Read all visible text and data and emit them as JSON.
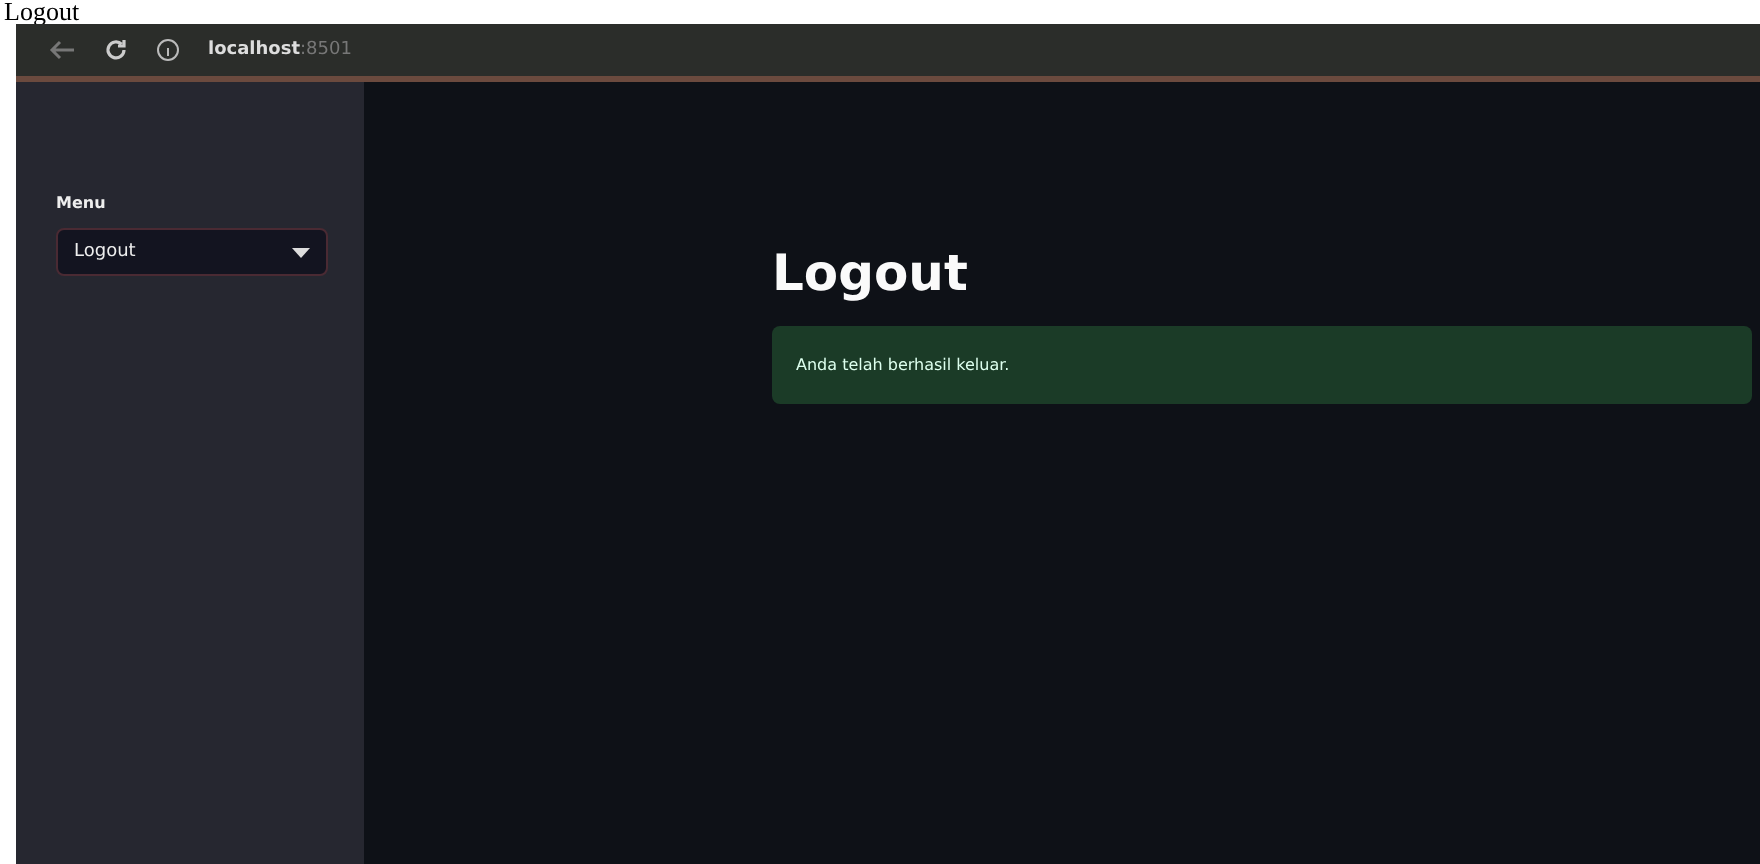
{
  "caption": "Logout",
  "browser": {
    "host": "localhost",
    "port": ":8501"
  },
  "sidebar": {
    "label": "Menu",
    "select": {
      "value": "Logout"
    }
  },
  "main": {
    "title": "Logout",
    "alert": {
      "kind": "success",
      "text": "Anda telah berhasil keluar."
    }
  }
}
